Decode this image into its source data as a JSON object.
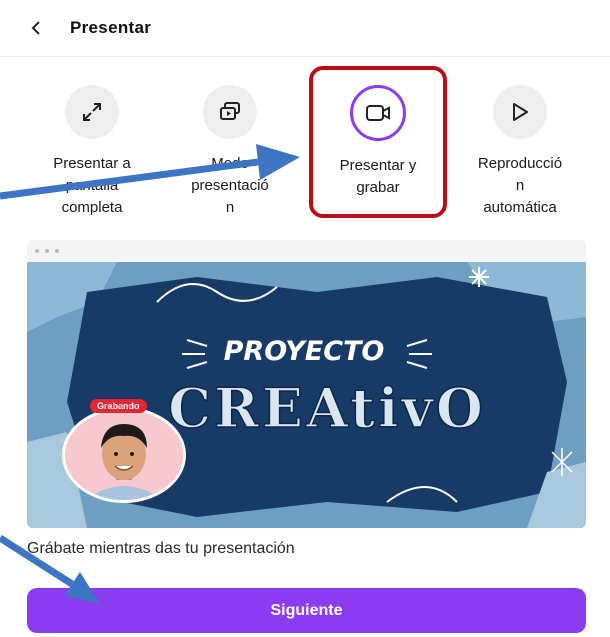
{
  "header": {
    "title": "Presentar",
    "back_icon": "chevron-left-icon"
  },
  "options": [
    {
      "label": "Presentar a\npantalla\ncompleta",
      "icon": "expand-icon"
    },
    {
      "label": "Modo\npresentació\nn",
      "icon": "presenter-view-icon"
    },
    {
      "label": "Presentar y\ngrabar",
      "icon": "video-camera-icon",
      "selected": true
    },
    {
      "label": "Reproducció\nn\nautomática",
      "icon": "play-icon"
    }
  ],
  "preview": {
    "slide_title_top": "PROYECTO",
    "slide_title_bottom": "CREAtivO",
    "recording_badge": "Grabando"
  },
  "caption": "Grábate mientras das tu presentación",
  "primary_button": {
    "label": "Siguiente"
  },
  "colors": {
    "accent": "#8b3cf0",
    "highlight": "#b80e15",
    "annotation_arrow": "#3d74c4",
    "slide_bg": "#6e9fc2"
  }
}
